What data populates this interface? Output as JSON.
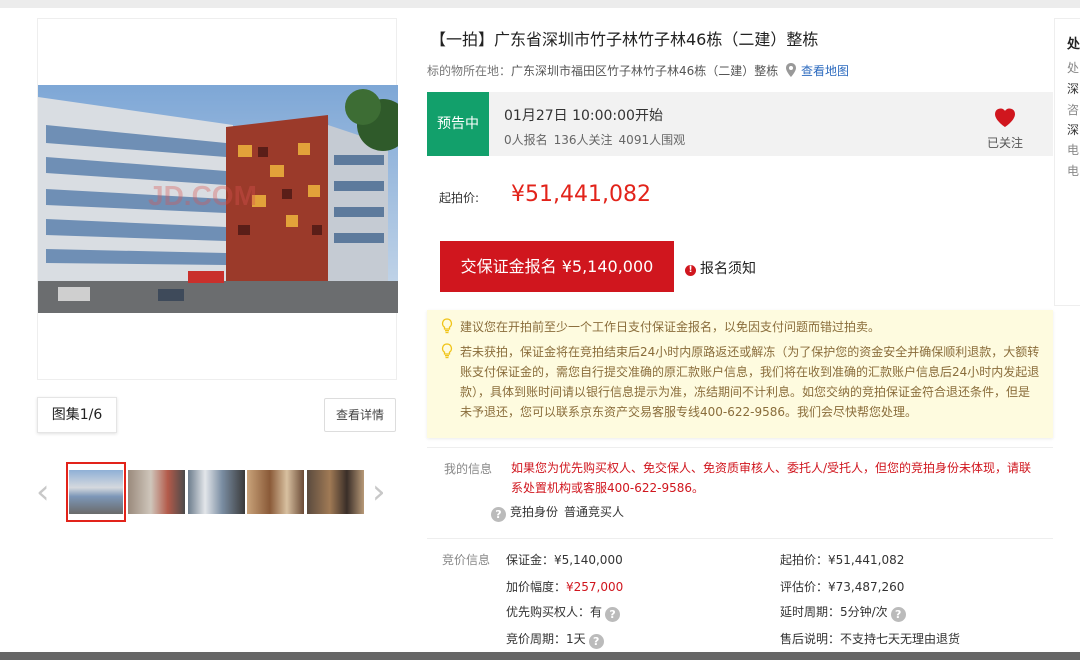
{
  "gallery": {
    "album_count": "图集1/6",
    "view_detail": "查看详情",
    "prev": "‹",
    "next": "›",
    "watermark": "JD.COM"
  },
  "listing": {
    "title": "【一拍】广东省深圳市竹子林竹子林46栋（二建）整栋",
    "location_label": "标的物所在地：",
    "location_value": "广东深圳市福田区竹子林竹子林46栋（二建）整栋",
    "map_link": "查看地图"
  },
  "status": {
    "badge": "预告中",
    "start_time": "01月27日 10:00:00开始",
    "signups": "0人报名",
    "followers": "136人关注",
    "viewers": "4091人围观",
    "follow_label": "已关注"
  },
  "price": {
    "label": "起拍价:",
    "value": "¥51,441,082"
  },
  "deposit": {
    "button": "交保证金报名 ¥5,140,000",
    "notice": "报名须知"
  },
  "tips": [
    "建议您在开拍前至少一个工作日支付保证金报名，以免因支付问题而错过拍卖。",
    "若未获拍，保证金将在竞拍结束后24小时内原路返还或解冻（为了保护您的资金安全并确保顺利退款，大额转账支付保证金的，需您自行提交准确的原汇款账户信息，我们将在收到准确的汇款账户信息后24小时内发起退款），具体到账时间请以银行信息提示为准，冻结期间不计利息。如您交纳的竞拍保证金符合退还条件，但是未予退还，您可以联系京东资产交易客服专线400-622-9586。我们会尽快帮您处理。"
  ],
  "my_info": {
    "label": "我的信息",
    "text": "如果您为优先购买权人、免交保人、免资质审核人、委托人/受托人，但您的竞拍身份未体现，请联系处置机构或客服400-622-9586。",
    "identity_label": "竞拍身份",
    "identity_value": "普通竞买人"
  },
  "bid_info": {
    "label": "竞价信息",
    "deposit": "保证金：¥5,140,000",
    "increment_label": "加价幅度：",
    "increment_value": "¥257,000",
    "priority": "优先购买权人：有",
    "cycle": "竞价周期：1天",
    "start_price": "起拍价：¥51,441,082",
    "appraisal": "评估价：¥73,487,260",
    "delay": "延时周期：5分钟/次",
    "after_sale": "售后说明：不支持七天无理由退货"
  },
  "right_panel": {
    "title": "处",
    "lines": [
      "处",
      "深",
      "咨",
      "深",
      "电",
      "电"
    ]
  },
  "colors": {
    "brand_red": "#d0161e",
    "badge_green": "#12a06b",
    "link_blue": "#2d6bbf",
    "tip_bg": "#fefbdf"
  }
}
